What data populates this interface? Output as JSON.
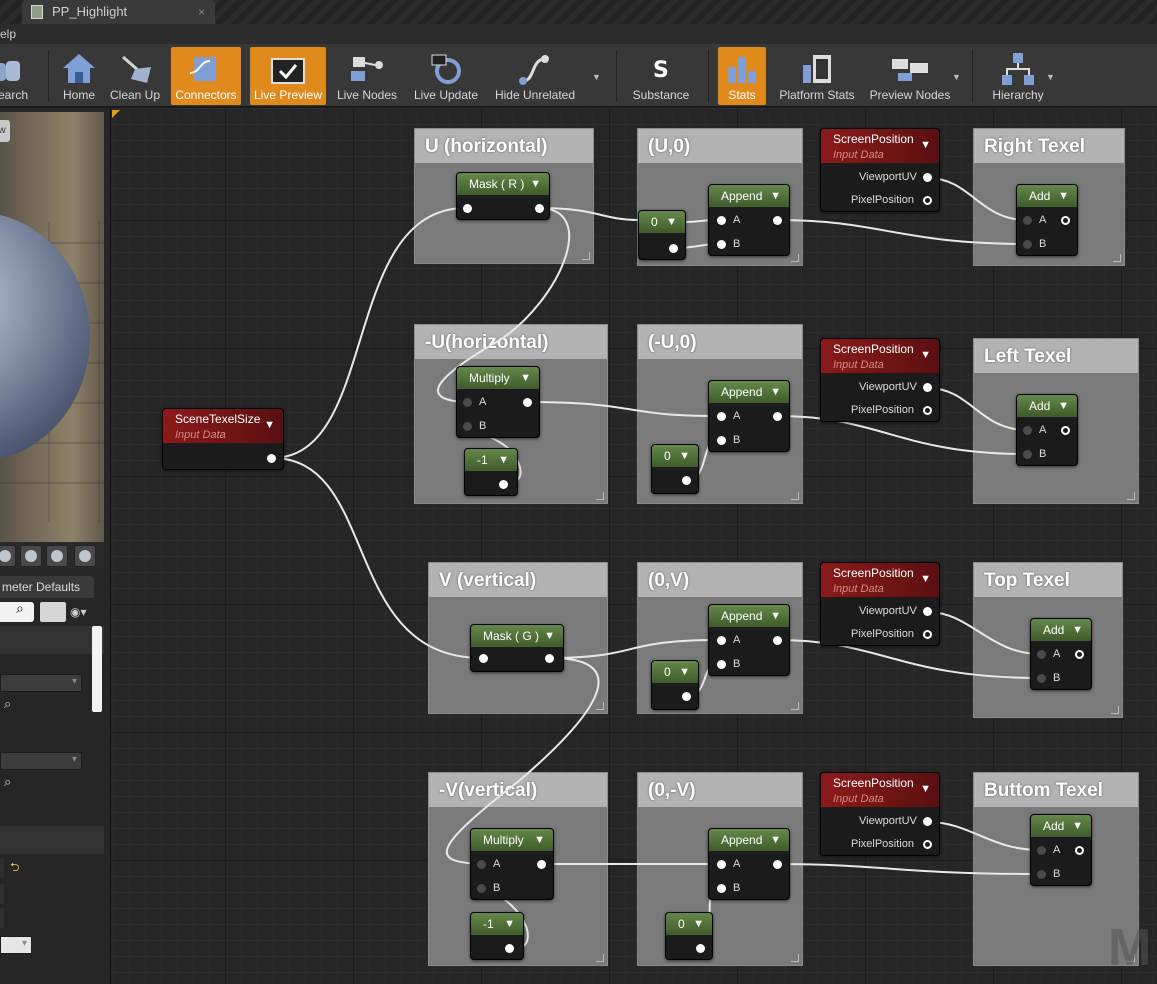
{
  "tab": {
    "title": "PP_Highlight",
    "close": "×"
  },
  "menu": {
    "help": "elp"
  },
  "toolbar": [
    {
      "id": "search",
      "label": "earch",
      "active": false
    },
    {
      "id": "home",
      "label": "Home",
      "active": false
    },
    {
      "id": "cleanup",
      "label": "Clean Up",
      "active": false
    },
    {
      "id": "connectors",
      "label": "Connectors",
      "active": true
    },
    {
      "id": "livepreview",
      "label": "Live Preview",
      "active": true
    },
    {
      "id": "livenodes",
      "label": "Live Nodes",
      "active": false
    },
    {
      "id": "liveupdate",
      "label": "Live Update",
      "active": false
    },
    {
      "id": "hideunrelated",
      "label": "Hide Unrelated",
      "active": false
    },
    {
      "id": "substance",
      "label": "Substance",
      "active": false
    },
    {
      "id": "stats",
      "label": "Stats",
      "active": true
    },
    {
      "id": "platformstats",
      "label": "Platform Stats",
      "active": false
    },
    {
      "id": "previewnodes",
      "label": "Preview Nodes",
      "active": false
    },
    {
      "id": "hierarchy",
      "label": "Hierarchy",
      "active": false
    }
  ],
  "viewport": {
    "button": "w"
  },
  "details": {
    "tab_label": "meter Defaults"
  },
  "graph": {
    "scene_texel_size": {
      "title": "SceneTexelSize",
      "subtitle": "Input Data"
    },
    "comments": {
      "u": "U (horizontal)",
      "nu": "-U(horizontal)",
      "v": "V (vertical)",
      "nv": "-V(vertical)",
      "u0": "(U,0)",
      "nu0": "(-U,0)",
      "v0": "(0,V)",
      "nv0": "(0,-V)",
      "right": "Right Texel",
      "left": "Left Texel",
      "top": "Top Texel",
      "bottom": "Buttom Texel"
    },
    "node_titles": {
      "mask_r": "Mask ( R )",
      "mask_g": "Mask ( G )",
      "multiply": "Multiply",
      "append": "Append",
      "add": "Add",
      "const_neg1": "-1",
      "const_0": "0",
      "screen_position": "ScreenPosition",
      "input_data": "Input Data"
    },
    "pins": {
      "a": "A",
      "b": "B",
      "viewport_uv": "ViewportUV",
      "pixel_position": "PixelPosition"
    }
  },
  "watermark": "M"
}
